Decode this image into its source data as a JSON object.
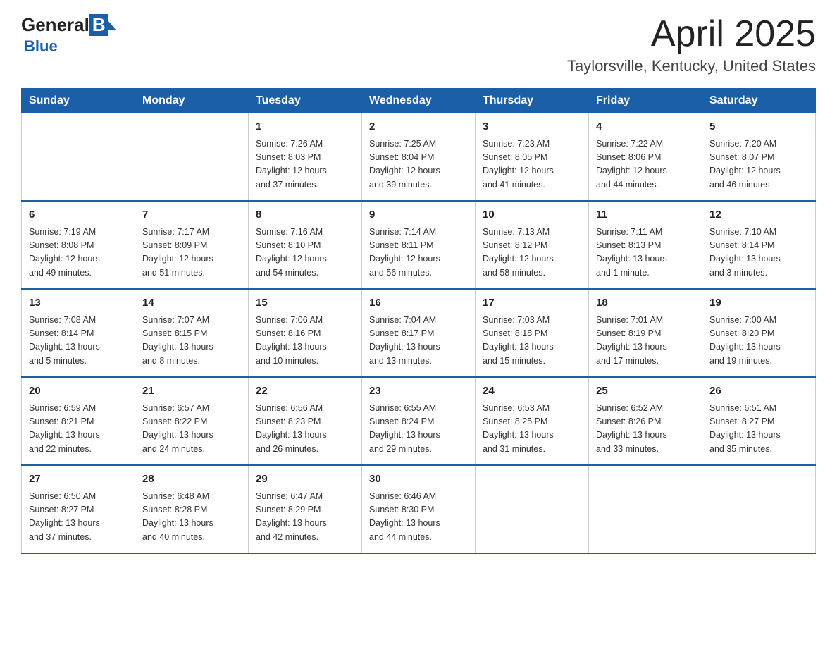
{
  "header": {
    "logo": {
      "general": "General",
      "blue": "Blue",
      "subtitle": "Blue"
    },
    "title": "April 2025",
    "subtitle": "Taylorsville, Kentucky, United States"
  },
  "calendar": {
    "days_of_week": [
      "Sunday",
      "Monday",
      "Tuesday",
      "Wednesday",
      "Thursday",
      "Friday",
      "Saturday"
    ],
    "weeks": [
      [
        {
          "day": "",
          "info": ""
        },
        {
          "day": "",
          "info": ""
        },
        {
          "day": "1",
          "info": "Sunrise: 7:26 AM\nSunset: 8:03 PM\nDaylight: 12 hours\nand 37 minutes."
        },
        {
          "day": "2",
          "info": "Sunrise: 7:25 AM\nSunset: 8:04 PM\nDaylight: 12 hours\nand 39 minutes."
        },
        {
          "day": "3",
          "info": "Sunrise: 7:23 AM\nSunset: 8:05 PM\nDaylight: 12 hours\nand 41 minutes."
        },
        {
          "day": "4",
          "info": "Sunrise: 7:22 AM\nSunset: 8:06 PM\nDaylight: 12 hours\nand 44 minutes."
        },
        {
          "day": "5",
          "info": "Sunrise: 7:20 AM\nSunset: 8:07 PM\nDaylight: 12 hours\nand 46 minutes."
        }
      ],
      [
        {
          "day": "6",
          "info": "Sunrise: 7:19 AM\nSunset: 8:08 PM\nDaylight: 12 hours\nand 49 minutes."
        },
        {
          "day": "7",
          "info": "Sunrise: 7:17 AM\nSunset: 8:09 PM\nDaylight: 12 hours\nand 51 minutes."
        },
        {
          "day": "8",
          "info": "Sunrise: 7:16 AM\nSunset: 8:10 PM\nDaylight: 12 hours\nand 54 minutes."
        },
        {
          "day": "9",
          "info": "Sunrise: 7:14 AM\nSunset: 8:11 PM\nDaylight: 12 hours\nand 56 minutes."
        },
        {
          "day": "10",
          "info": "Sunrise: 7:13 AM\nSunset: 8:12 PM\nDaylight: 12 hours\nand 58 minutes."
        },
        {
          "day": "11",
          "info": "Sunrise: 7:11 AM\nSunset: 8:13 PM\nDaylight: 13 hours\nand 1 minute."
        },
        {
          "day": "12",
          "info": "Sunrise: 7:10 AM\nSunset: 8:14 PM\nDaylight: 13 hours\nand 3 minutes."
        }
      ],
      [
        {
          "day": "13",
          "info": "Sunrise: 7:08 AM\nSunset: 8:14 PM\nDaylight: 13 hours\nand 5 minutes."
        },
        {
          "day": "14",
          "info": "Sunrise: 7:07 AM\nSunset: 8:15 PM\nDaylight: 13 hours\nand 8 minutes."
        },
        {
          "day": "15",
          "info": "Sunrise: 7:06 AM\nSunset: 8:16 PM\nDaylight: 13 hours\nand 10 minutes."
        },
        {
          "day": "16",
          "info": "Sunrise: 7:04 AM\nSunset: 8:17 PM\nDaylight: 13 hours\nand 13 minutes."
        },
        {
          "day": "17",
          "info": "Sunrise: 7:03 AM\nSunset: 8:18 PM\nDaylight: 13 hours\nand 15 minutes."
        },
        {
          "day": "18",
          "info": "Sunrise: 7:01 AM\nSunset: 8:19 PM\nDaylight: 13 hours\nand 17 minutes."
        },
        {
          "day": "19",
          "info": "Sunrise: 7:00 AM\nSunset: 8:20 PM\nDaylight: 13 hours\nand 19 minutes."
        }
      ],
      [
        {
          "day": "20",
          "info": "Sunrise: 6:59 AM\nSunset: 8:21 PM\nDaylight: 13 hours\nand 22 minutes."
        },
        {
          "day": "21",
          "info": "Sunrise: 6:57 AM\nSunset: 8:22 PM\nDaylight: 13 hours\nand 24 minutes."
        },
        {
          "day": "22",
          "info": "Sunrise: 6:56 AM\nSunset: 8:23 PM\nDaylight: 13 hours\nand 26 minutes."
        },
        {
          "day": "23",
          "info": "Sunrise: 6:55 AM\nSunset: 8:24 PM\nDaylight: 13 hours\nand 29 minutes."
        },
        {
          "day": "24",
          "info": "Sunrise: 6:53 AM\nSunset: 8:25 PM\nDaylight: 13 hours\nand 31 minutes."
        },
        {
          "day": "25",
          "info": "Sunrise: 6:52 AM\nSunset: 8:26 PM\nDaylight: 13 hours\nand 33 minutes."
        },
        {
          "day": "26",
          "info": "Sunrise: 6:51 AM\nSunset: 8:27 PM\nDaylight: 13 hours\nand 35 minutes."
        }
      ],
      [
        {
          "day": "27",
          "info": "Sunrise: 6:50 AM\nSunset: 8:27 PM\nDaylight: 13 hours\nand 37 minutes."
        },
        {
          "day": "28",
          "info": "Sunrise: 6:48 AM\nSunset: 8:28 PM\nDaylight: 13 hours\nand 40 minutes."
        },
        {
          "day": "29",
          "info": "Sunrise: 6:47 AM\nSunset: 8:29 PM\nDaylight: 13 hours\nand 42 minutes."
        },
        {
          "day": "30",
          "info": "Sunrise: 6:46 AM\nSunset: 8:30 PM\nDaylight: 13 hours\nand 44 minutes."
        },
        {
          "day": "",
          "info": ""
        },
        {
          "day": "",
          "info": ""
        },
        {
          "day": "",
          "info": ""
        }
      ]
    ]
  }
}
